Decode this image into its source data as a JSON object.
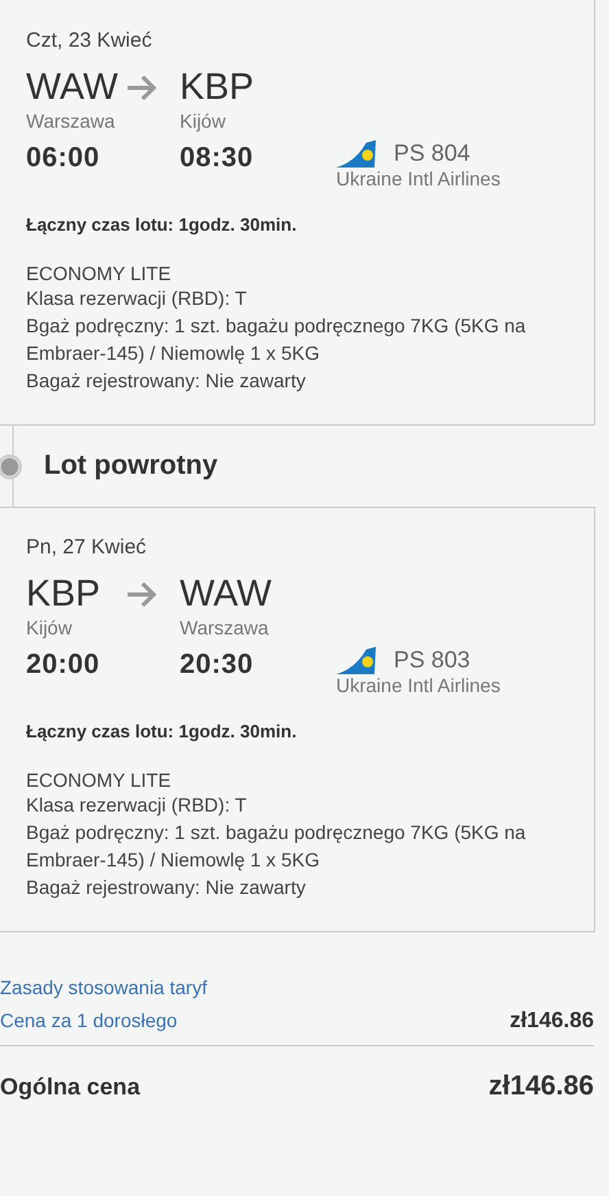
{
  "flights": [
    {
      "date": "Czt, 23 Kwieć",
      "from_code": "WAW",
      "from_city": "Warszawa",
      "to_code": "KBP",
      "to_city": "Kijów",
      "depart": "06:00",
      "arrive": "08:30",
      "flight_no": "PS 804",
      "airline": "Ukraine Intl Airlines",
      "duration": "Łączny czas lotu: 1godz. 30min.",
      "fare": "ECONOMY LITE",
      "details": [
        "Klasa rezerwacji (RBD):  T",
        "Bgaż podręczny: 1 szt. bagażu podręcznego 7KG (5KG na Embraer-145) / Niemowlę 1 x 5KG",
        "Bagaż rejestrowany: Nie zawarty"
      ]
    },
    {
      "date": "Pn, 27 Kwieć",
      "from_code": "KBP",
      "from_city": "Kijów",
      "to_code": "WAW",
      "to_city": "Warszawa",
      "depart": "20:00",
      "arrive": "20:30",
      "flight_no": "PS 803",
      "airline": "Ukraine Intl Airlines",
      "duration": "Łączny czas lotu: 1godz. 30min.",
      "fare": "ECONOMY LITE",
      "details": [
        "Klasa rezerwacji (RBD):  T",
        "Bgaż podręczny: 1 szt. bagażu podręcznego 7KG (5KG na Embraer-145) / Niemowlę 1 x 5KG",
        "Bagaż rejestrowany: Nie zawarty"
      ]
    }
  ],
  "return_heading": "Lot powrotny",
  "fare_rules_link": "Zasady stosowania taryf",
  "price_per_adult": {
    "label": "Cena za 1 dorosłego",
    "value": "zł146.86"
  },
  "total": {
    "label": "Ogólna cena",
    "value": "zł146.86"
  }
}
